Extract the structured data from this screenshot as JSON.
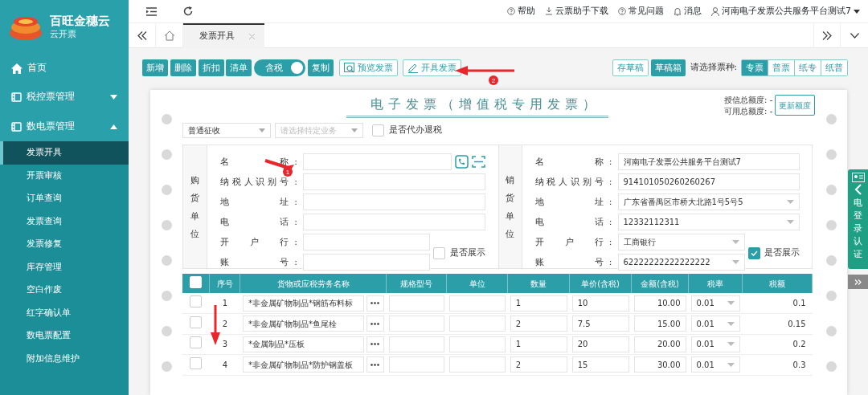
{
  "brand": {
    "name": "百旺金穗云",
    "subtitle": "云开票"
  },
  "sidebar": {
    "items": [
      {
        "label": "首页",
        "kind": "home"
      },
      {
        "label": "税控票管理",
        "kind": "group",
        "expanded": false
      },
      {
        "label": "数电票管理",
        "kind": "group",
        "expanded": true,
        "children": [
          {
            "label": "发票开具",
            "selected": true
          },
          {
            "label": "开票审核",
            "selected": false
          },
          {
            "label": "订单查询",
            "selected": false
          },
          {
            "label": "发票查询",
            "selected": false
          },
          {
            "label": "发票修复",
            "selected": false
          },
          {
            "label": "库存管理",
            "selected": false
          },
          {
            "label": "空白作废",
            "selected": false
          },
          {
            "label": "红字确认单",
            "selected": false
          },
          {
            "label": "数电票配置",
            "selected": false
          },
          {
            "label": "附加信息维护",
            "selected": false
          }
        ]
      }
    ]
  },
  "topbar": {
    "links": [
      {
        "label": "帮助",
        "kind": "help"
      },
      {
        "label": "云票助手下载",
        "kind": "download"
      },
      {
        "label": "常见问题",
        "kind": "help"
      },
      {
        "label": "消息",
        "kind": "bell"
      }
    ],
    "user": "河南电子发票公共服务平台测试7"
  },
  "tabs": [
    {
      "label": "发票开具",
      "selected": true
    }
  ],
  "toolbar": {
    "buttons": [
      {
        "label": "新增",
        "kind": "fill"
      },
      {
        "label": "删除",
        "kind": "fill"
      },
      {
        "label": "折扣",
        "kind": "fill"
      },
      {
        "label": "清单",
        "kind": "fill"
      },
      {
        "label": "含税",
        "kind": "toggle",
        "on": true
      },
      {
        "label": "复制",
        "kind": "fill"
      },
      {
        "label": "预览发票",
        "kind": "preview"
      },
      {
        "label": "开具发票",
        "kind": "issue"
      }
    ],
    "right_buttons": [
      {
        "label": "存草稿",
        "kind": "outline"
      },
      {
        "label": "草稿箱",
        "kind": "fill"
      }
    ],
    "type_label": "请选择票种:",
    "types": [
      {
        "label": "专票",
        "selected": true
      },
      {
        "label": "普票",
        "selected": false
      },
      {
        "label": "纸专",
        "selected": false
      },
      {
        "label": "纸普",
        "selected": false
      }
    ]
  },
  "invoice": {
    "title": "电子发票（增值税专用发票）",
    "quota": [
      "授信总额度: -",
      "可用总额度: -"
    ],
    "quota_button": "更新额度",
    "levy_select": {
      "value": "普通征收"
    },
    "business_select": {
      "placeholder": "请选择特定业务"
    },
    "refund_checkbox": {
      "label": "是否代办退税",
      "checked": false
    },
    "parties": [
      {
        "side": "购货单位",
        "fields": [
          {
            "label": "名称",
            "colon": ":",
            "lookup": true
          },
          {
            "label": "纳税人识别号",
            "colon": ":"
          },
          {
            "label": "地址",
            "colon": ":"
          },
          {
            "label": "电话",
            "colon": ":"
          },
          {
            "label": "开户行",
            "colon": ":",
            "short": true
          },
          {
            "label": "账号",
            "colon": ":",
            "short": true
          }
        ],
        "show": {
          "label": "是否展示",
          "checked": false
        }
      },
      {
        "side": "销货单位",
        "fields": [
          {
            "label": "名称",
            "colon": ":",
            "value": "河南电子发票公共服务平台测试7"
          },
          {
            "label": "纳税人识别号",
            "colon": ":",
            "value": "914101050260260267"
          },
          {
            "label": "地址",
            "colon": ":",
            "value": "广东省番禺区市桥大北路1号5号5",
            "dropdown": true
          },
          {
            "label": "电话",
            "colon": ":",
            "value": "12332112311",
            "dropdown": true
          },
          {
            "label": "开户行",
            "colon": ":",
            "value": "工商银行",
            "short": true,
            "dropdown": true
          },
          {
            "label": "账号",
            "colon": ":",
            "value": "62222222222222222",
            "short": true,
            "dropdown": true
          }
        ],
        "show": {
          "label": "是否展示",
          "checked": true
        }
      }
    ]
  },
  "table": {
    "select_all_checked": false,
    "columns": [
      "序号",
      "货物或应税劳务名称",
      "规格型号",
      "单位",
      "数量",
      "单价(含税)",
      "金额(含税)",
      "税率",
      "税额"
    ],
    "rows": [
      {
        "no": "1",
        "name": "*非金属矿物制品*钢筋布料标",
        "qty": "1",
        "price": "10",
        "amount": "10.00",
        "rate": "0.01",
        "tax": "0.1",
        "checked": false
      },
      {
        "no": "2",
        "name": "*非金属矿物制品*鱼尾栓",
        "qty": "2",
        "price": "7.5",
        "amount": "15.00",
        "rate": "0.01",
        "tax": "0.15",
        "checked": false
      },
      {
        "no": "3",
        "name": "*金属制品*压板",
        "qty": "1",
        "price": "20",
        "amount": "20.00",
        "rate": "0.01",
        "tax": "0.2",
        "checked": false
      },
      {
        "no": "4",
        "name": "*非金属矿物制品*防护钢盖板",
        "qty": "2",
        "price": "15",
        "amount": "30.00",
        "rate": "0.01",
        "tax": "0.3",
        "checked": false
      }
    ]
  },
  "side_panel": {
    "label": "电登录认证"
  },
  "annotations": [
    {
      "kind": "arrow",
      "badge": "1"
    },
    {
      "kind": "arrow",
      "badge": "2"
    },
    {
      "kind": "arrow"
    }
  ]
}
